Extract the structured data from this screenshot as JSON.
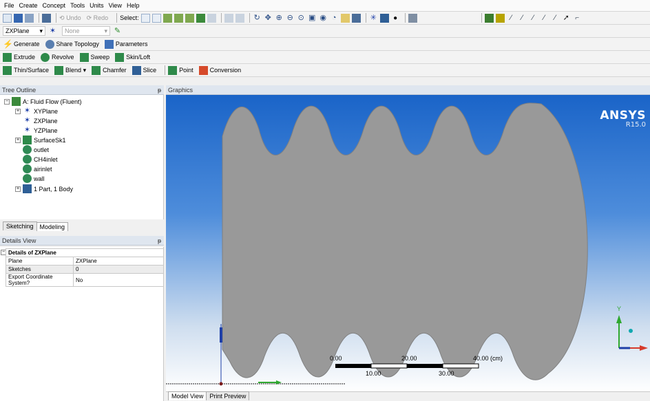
{
  "menu": [
    "File",
    "Create",
    "Concept",
    "Tools",
    "Units",
    "View",
    "Help"
  ],
  "toolbar": {
    "undo": "Undo",
    "redo": "Redo",
    "select": "Select:",
    "plane_value": "ZXPlane",
    "sketch_value": "None",
    "generate": "Generate",
    "share_topology": "Share Topology",
    "parameters": "Parameters",
    "extrude": "Extrude",
    "revolve": "Revolve",
    "sweep": "Sweep",
    "skin_loft": "Skin/Loft",
    "thin_surface": "Thin/Surface",
    "blend": "Blend",
    "chamfer": "Chamfer",
    "slice": "Slice",
    "point": "Point",
    "conversion": "Conversion"
  },
  "tree": {
    "title": "Tree Outline",
    "root": "A: Fluid Flow (Fluent)",
    "items": [
      "XYPlane",
      "ZXPlane",
      "YZPlane",
      "SurfaceSk1",
      "outlet",
      "CH4inlet",
      "airinlet",
      "wall",
      "1 Part, 1 Body"
    ]
  },
  "left_tabs": [
    "Sketching",
    "Modeling"
  ],
  "details": {
    "title": "Details View",
    "header": "Details of ZXPlane",
    "rows": [
      {
        "label": "Plane",
        "value": "ZXPlane"
      },
      {
        "label": "Sketches",
        "value": "0"
      },
      {
        "label": "Export Coordinate System?",
        "value": "No"
      }
    ]
  },
  "graphics": {
    "title": "Graphics",
    "brand": "ANSYS",
    "version": "R15.0",
    "scale_top": [
      "0.00",
      "20.00",
      "40.00 (cm)"
    ],
    "scale_bottom": [
      "10.00",
      "30.00"
    ],
    "axis_y": "Y"
  },
  "graphics_tabs": [
    "Model View",
    "Print Preview"
  ],
  "colors": {
    "accent_blue": "#1a64c8",
    "geometry_fill": "#999999",
    "axis_green": "#2fa82f",
    "axis_blue": "#1e3fa8",
    "axis_cyan": "#10a8b0"
  }
}
